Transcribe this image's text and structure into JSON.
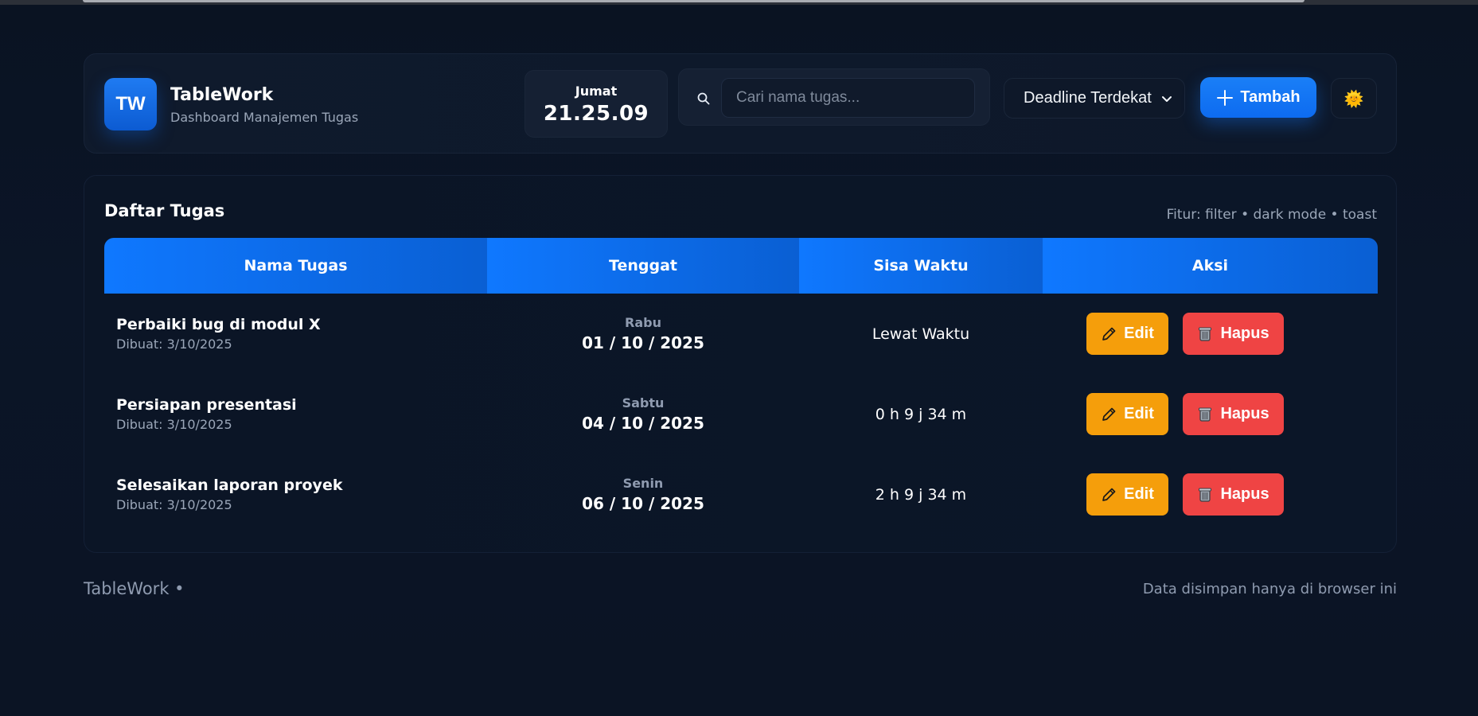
{
  "brand": {
    "logo_text": "TW",
    "title": "TableWork",
    "subtitle": "Dashboard Manajemen Tugas"
  },
  "clock": {
    "day": "Jumat",
    "time": "21.25.09"
  },
  "search": {
    "placeholder": "Cari nama tugas...",
    "value": ""
  },
  "sort": {
    "selected": "Deadline Terdekat"
  },
  "add_button": {
    "label": "Tambah"
  },
  "theme_toggle": {
    "icon": "sun-icon",
    "glyph": "🌞"
  },
  "main": {
    "title": "Daftar Tugas",
    "features": "Fitur: filter • dark mode • toast",
    "columns": [
      "Nama Tugas",
      "Tenggat",
      "Sisa Waktu",
      "Aksi"
    ],
    "rows": [
      {
        "name": "Perbaiki bug di modul X",
        "created": "Dibuat: 3/10/2025",
        "deadline_day": "Rabu",
        "deadline_date": "01 / 10 / 2025",
        "remaining": "Lewat Waktu",
        "edit_label": "Edit",
        "delete_label": "Hapus"
      },
      {
        "name": "Persiapan presentasi",
        "created": "Dibuat: 3/10/2025",
        "deadline_day": "Sabtu",
        "deadline_date": "04 / 10 / 2025",
        "remaining": "0 h 9 j 34 m",
        "edit_label": "Edit",
        "delete_label": "Hapus"
      },
      {
        "name": "Selesaikan laporan proyek",
        "created": "Dibuat: 3/10/2025",
        "deadline_day": "Senin",
        "deadline_date": "06 / 10 / 2025",
        "remaining": "2 h 9 j 34 m",
        "edit_label": "Edit",
        "delete_label": "Hapus"
      }
    ]
  },
  "footer": {
    "left": "TableWork •",
    "right": "Data disimpan hanya di browser ini"
  },
  "colors": {
    "accent": "#0f78ff",
    "edit": "#f59e0b",
    "delete": "#ef4444",
    "background": "#0b1424"
  }
}
